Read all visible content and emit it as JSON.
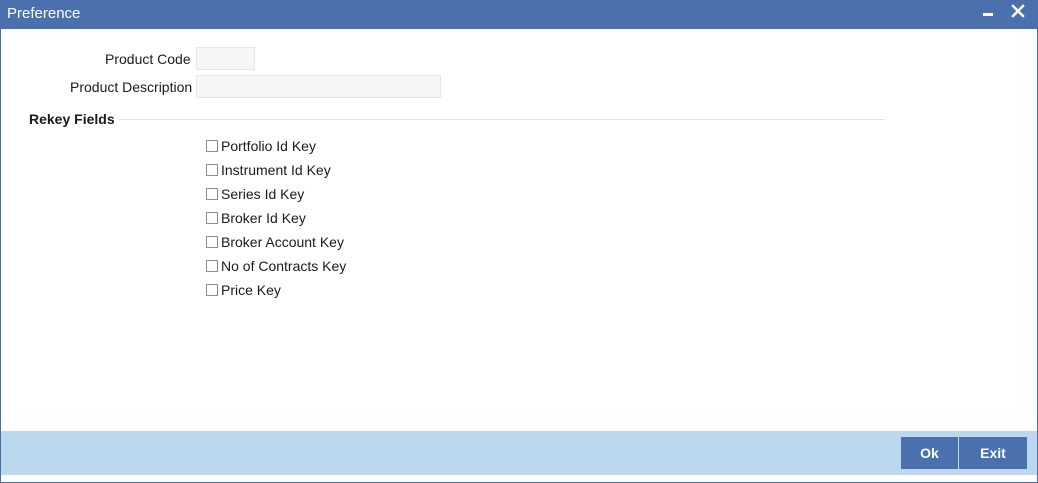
{
  "window": {
    "title": "Preference"
  },
  "form": {
    "product_code_label": "Product Code",
    "product_code_value": "",
    "product_description_label": "Product Description",
    "product_description_value": ""
  },
  "rekey": {
    "title": "Rekey Fields",
    "fields": [
      {
        "label": "Portfolio Id Key",
        "checked": false
      },
      {
        "label": "Instrument Id Key",
        "checked": false
      },
      {
        "label": "Series Id Key",
        "checked": false
      },
      {
        "label": "Broker Id Key",
        "checked": false
      },
      {
        "label": "Broker Account Key",
        "checked": false
      },
      {
        "label": "No of Contracts Key",
        "checked": false
      },
      {
        "label": "Price Key",
        "checked": false
      }
    ]
  },
  "footer": {
    "ok_label": "Ok",
    "exit_label": "Exit"
  },
  "colors": {
    "titlebar": "#4a71ad",
    "footer": "#bcd8ee",
    "button": "#4a71ad"
  }
}
